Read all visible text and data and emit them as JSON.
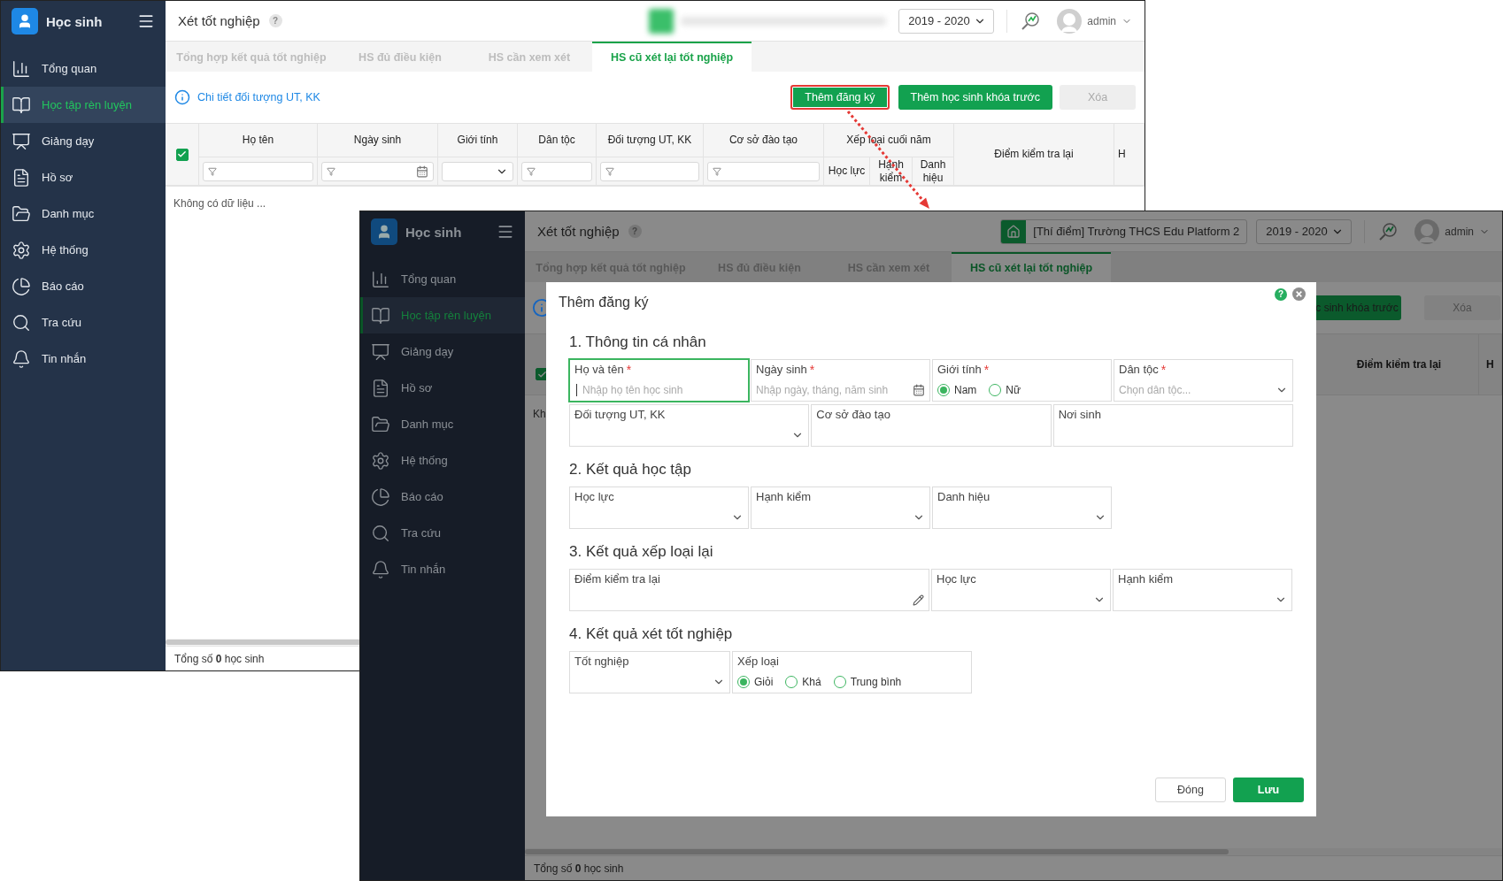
{
  "back_screenshot": {
    "app_title": "Học sinh",
    "sidebar": [
      {
        "label": "Tổng quan",
        "selected": false
      },
      {
        "label": "Học tập rèn luyện",
        "selected": true
      },
      {
        "label": "Giảng dạy",
        "selected": false
      },
      {
        "label": "Hồ sơ",
        "selected": false
      },
      {
        "label": "Danh mục",
        "selected": false
      },
      {
        "label": "Hệ thống",
        "selected": false
      },
      {
        "label": "Báo cáo",
        "selected": false
      },
      {
        "label": "Tra cứu",
        "selected": false
      },
      {
        "label": "Tin nhắn",
        "selected": false
      }
    ],
    "page_title": "Xét tốt nghiệp",
    "help": "?",
    "year": "2019 - 2020",
    "user": "admin",
    "tabs": [
      {
        "label": "Tổng hợp kết quả tốt nghiệp",
        "selected": false
      },
      {
        "label": "HS đủ điều kiện",
        "selected": false
      },
      {
        "label": "HS cần xem xét",
        "selected": false
      },
      {
        "label": "HS cũ xét lại tốt nghiệp",
        "selected": true
      }
    ],
    "info_link": "Chi tiết đối tượng UT, KK",
    "buttons": [
      {
        "label": "Thêm đăng ký",
        "kind": "primary",
        "highlighted": true
      },
      {
        "label": "Thêm học sinh khóa trước",
        "kind": "primary",
        "highlighted": false
      },
      {
        "label": "Xóa",
        "kind": "disabled",
        "highlighted": false
      }
    ],
    "select_all_checked": true,
    "columns": [
      {
        "label": "Họ tên",
        "kind": "text"
      },
      {
        "label": "Ngày sinh",
        "kind": "date"
      },
      {
        "label": "Giới tính",
        "kind": "select"
      },
      {
        "label": "Dân tộc",
        "kind": "text"
      },
      {
        "label": "Đối tượng UT, KK",
        "kind": "text"
      },
      {
        "label": "Cơ sở đào tạo",
        "kind": "text"
      }
    ],
    "column_group": {
      "label": "Xếp loại cuối năm",
      "columns": [
        "Học lực",
        "Hạnh kiểm",
        "Danh hiệu"
      ]
    },
    "extra_columns": [
      "Điểm kiểm tra lại",
      "H"
    ],
    "empty_text": "Không có dữ liệu ...",
    "footer": "Tổng số **0** học sinh"
  },
  "front_screenshot": {
    "app_title": "Học sinh",
    "sidebar": [
      {
        "label": "Tổng quan",
        "selected": false
      },
      {
        "label": "Học tập rèn luyện",
        "selected": true
      },
      {
        "label": "Giảng dạy",
        "selected": false
      },
      {
        "label": "Hồ sơ",
        "selected": false
      },
      {
        "label": "Danh mục",
        "selected": false
      },
      {
        "label": "Hệ thống",
        "selected": false
      },
      {
        "label": "Báo cáo",
        "selected": false
      },
      {
        "label": "Tra cứu",
        "selected": false
      },
      {
        "label": "Tin nhắn",
        "selected": false
      }
    ],
    "page_title": "Xét tốt nghiệp",
    "help": "?",
    "school": "[Thí điểm] Trường THCS Edu Platform 2",
    "year": "2019 - 2020",
    "user": "admin",
    "tabs": [
      {
        "label": "Tổng hợp kết quả tốt nghiệp",
        "selected": false
      },
      {
        "label": "HS đủ điều kiện",
        "selected": false
      },
      {
        "label": "HS cần xem xét",
        "selected": false
      },
      {
        "label": "HS cũ xét lại tốt nghiệp",
        "selected": true
      }
    ],
    "buttons": [
      {
        "label": "c sinh khóa trước",
        "kind": "primary"
      },
      {
        "label": "Xóa",
        "kind": "disabled"
      }
    ],
    "select_all_checked": true,
    "columns": [
      "Điểm kiểm tra lại",
      "H"
    ],
    "empty_text": "Kh",
    "footer": "Tổng số **0** học sinh",
    "dialog": {
      "title": "Thêm đăng ký",
      "help": "?",
      "sections": [
        {
          "title": "1. Thông tin cá nhân",
          "rows": [
            [
              {
                "kind": "text",
                "label": "Họ và tên",
                "required_mark": "*",
                "placeholder": "Nhập họ tên học sinh",
                "focused": true
              },
              {
                "kind": "date",
                "label": "Ngày sinh",
                "required_mark": "*",
                "placeholder": "Nhập ngày, tháng, năm sinh",
                "focused": false
              },
              {
                "kind": "radio",
                "label": "Giới tính",
                "required_mark": "*",
                "focused": false,
                "options": [
                  {
                    "label": "Nam",
                    "selected": true
                  },
                  {
                    "label": "Nữ",
                    "selected": false
                  }
                ]
              },
              {
                "kind": "select",
                "label": "Dân tộc",
                "required_mark": "*",
                "placeholder": "Chọn dân tộc...",
                "focused": false
              }
            ],
            [
              {
                "kind": "select",
                "label": "Đối tượng UT, KK",
                "focused": false
              },
              {
                "kind": "plain",
                "label": "Cơ sở đào tạo",
                "focused": false
              },
              {
                "kind": "plain",
                "label": "Nơi sinh",
                "focused": false
              }
            ]
          ]
        },
        {
          "title": "2. Kết quả học tập",
          "rows": [
            [
              {
                "kind": "select",
                "label": "Học lực",
                "focused": false
              },
              {
                "kind": "select",
                "label": "Hạnh kiểm",
                "focused": false
              },
              {
                "kind": "select",
                "label": "Danh hiệu",
                "focused": false
              }
            ]
          ]
        },
        {
          "title": "3. Kết quả xếp loại lại",
          "rows": [
            [
              {
                "kind": "edit",
                "label": "Điểm kiểm tra lại",
                "focused": false
              },
              {
                "kind": "select",
                "label": "Học lực",
                "focused": false
              },
              {
                "kind": "select",
                "label": "Hạnh kiểm",
                "focused": false
              }
            ]
          ]
        },
        {
          "title": "4. Kết quả xét tốt nghiệp",
          "rows": [
            [
              {
                "kind": "select",
                "label": "Tốt nghiệp",
                "focused": false
              },
              {
                "kind": "radio",
                "label": "Xếp loại",
                "focused": false,
                "options": [
                  {
                    "label": "Giỏi",
                    "selected": true
                  },
                  {
                    "label": "Khá",
                    "selected": false
                  },
                  {
                    "label": "Trung bình",
                    "selected": false
                  }
                ]
              }
            ]
          ]
        }
      ],
      "buttons": [
        {
          "label": "Đóng",
          "kind": "secondary"
        },
        {
          "label": "Lưu",
          "kind": "primary"
        }
      ]
    }
  }
}
